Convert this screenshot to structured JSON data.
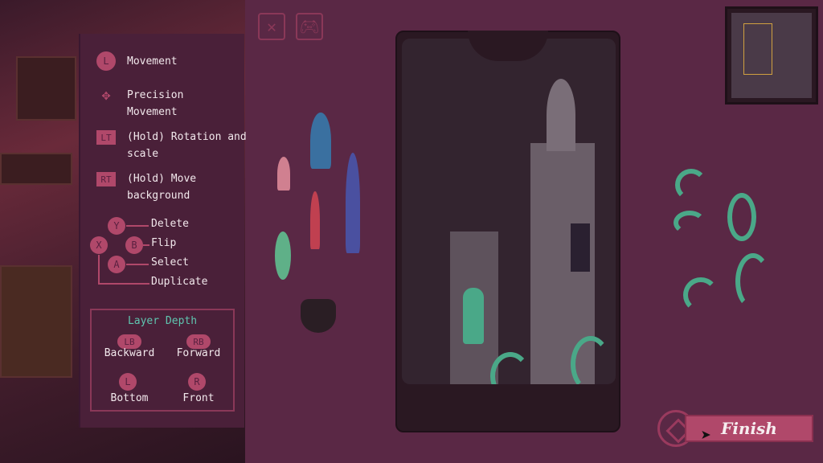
{
  "controls": [
    {
      "button": "L",
      "label": "Movement",
      "icon": "left-stick-icon"
    },
    {
      "button": "",
      "label": "Precision Movement",
      "icon": "dpad-icon"
    },
    {
      "button": "LT",
      "label": "(Hold) Rotation and scale",
      "icon": "left-trigger-icon"
    },
    {
      "button": "RT",
      "label": "(Hold) Move background",
      "icon": "right-trigger-icon"
    }
  ],
  "face_buttons": {
    "y": {
      "button": "Y",
      "label": "Delete"
    },
    "b": {
      "button": "B",
      "label": "Flip"
    },
    "a": {
      "button": "A",
      "label": "Select"
    },
    "x": {
      "button": "X",
      "label": "Duplicate"
    }
  },
  "layer_depth": {
    "title": "Layer Depth",
    "backward": {
      "button": "LB",
      "label": "Backward"
    },
    "forward": {
      "button": "RB",
      "label": "Forward"
    },
    "bottom": {
      "button": "L",
      "label": "Bottom"
    },
    "front": {
      "button": "R",
      "label": "Front"
    }
  },
  "top_icons": [
    "close-icon",
    "gamepad-icon"
  ],
  "finish_label": "Finish",
  "colors": {
    "background": "#5a2845",
    "panel": "#4a2039",
    "accent": "#b0486a",
    "teal": "#5fc6b0"
  }
}
